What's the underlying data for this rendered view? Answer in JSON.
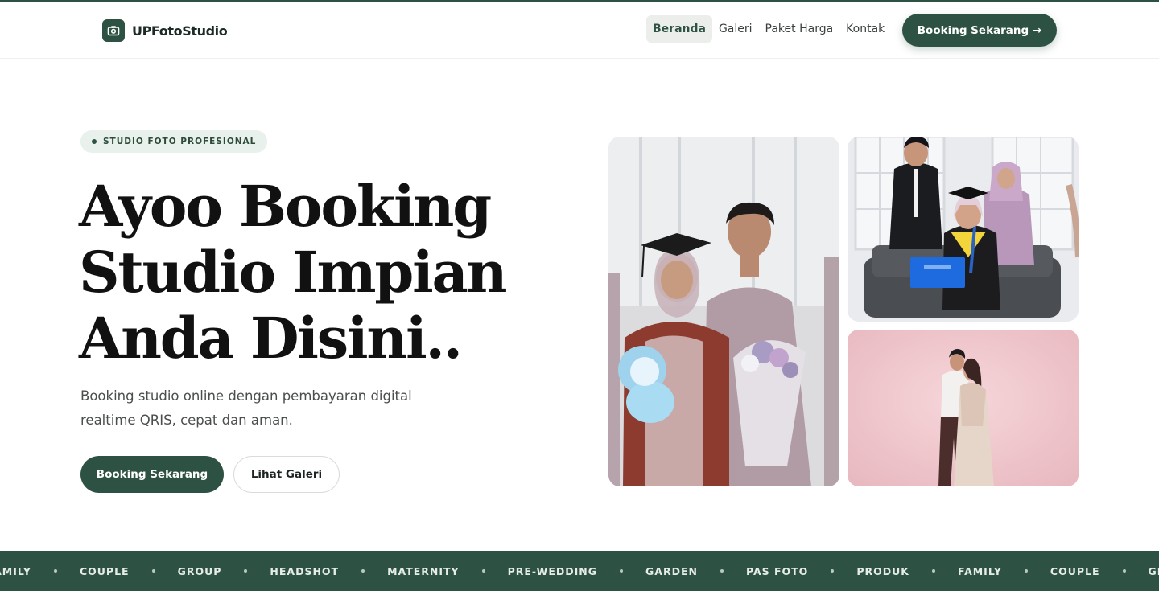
{
  "brand": {
    "name": "UPFotoStudio",
    "icon": "camera-icon"
  },
  "nav": {
    "items": [
      {
        "label": "Beranda",
        "active": true
      },
      {
        "label": "Galeri",
        "active": false
      },
      {
        "label": "Paket Harga",
        "active": false
      },
      {
        "label": "Kontak",
        "active": false
      }
    ],
    "booking_label": "Booking Sekarang →"
  },
  "hero": {
    "badge": "STUDIO FOTO PROFESIONAL",
    "title_lines": [
      "Ayoo Booking",
      "Studio Impian",
      "Anda Disini.."
    ],
    "subtitle": "Booking studio online dengan pembayaran digital realtime QRIS, cepat dan aman.",
    "primary_button": "Booking Sekarang",
    "secondary_button": "Lihat Galeri"
  },
  "gallery": {
    "photos": [
      "graduation-couple-photo",
      "graduation-family-photo",
      "prewedding-couple-photo"
    ]
  },
  "categories": [
    "FAMILY",
    "COUPLE",
    "GROUP",
    "HEADSHOT",
    "MATERNITY",
    "PRE-WEDDING",
    "GARDEN",
    "PAS FOTO",
    "PRODUK",
    "FAMILY",
    "COUPLE",
    "GROUP"
  ],
  "colors": {
    "primary": "#2d5243",
    "badge_bg": "#e8f1ec",
    "text": "#111111"
  }
}
